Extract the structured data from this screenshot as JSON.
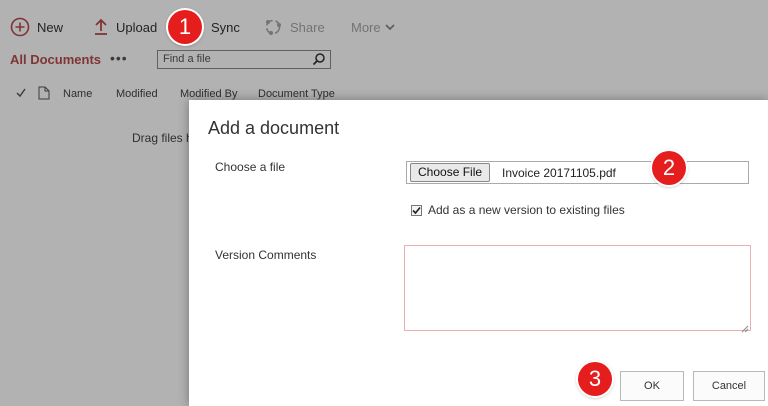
{
  "toolbar": {
    "new_label": "New",
    "upload_label": "Upload",
    "sync_label": "Sync",
    "share_label": "Share",
    "more_label": "More"
  },
  "library": {
    "view_name": "All Documents",
    "more_dots": "•••",
    "search_placeholder": "Find a file"
  },
  "columns": [
    "Name",
    "Modified",
    "Modified By",
    "Document Type"
  ],
  "drag_text": "Drag files h",
  "dialog": {
    "title": "Add a document",
    "choose_file_label": "Choose a file",
    "choose_file_button": "Choose File",
    "file_name": "Invoice 20171105.pdf",
    "checkbox_label": "Add as a new version to existing files",
    "checkbox_checked": true,
    "version_comments_label": "Version Comments",
    "version_comments_value": "",
    "ok_label": "OK",
    "cancel_label": "Cancel"
  },
  "callouts": [
    "1",
    "2",
    "3"
  ],
  "colors": {
    "accent": "#b84c4c",
    "callout": "#e51d1d",
    "overlay": "rgba(0,0,0,0.30)"
  },
  "icons": [
    "plus-circle-icon",
    "upload-arrow-icon",
    "sync-icon",
    "share-icon",
    "chevron-down-icon",
    "search-icon",
    "checkmark-icon",
    "document-icon",
    "resize-grip-icon"
  ]
}
